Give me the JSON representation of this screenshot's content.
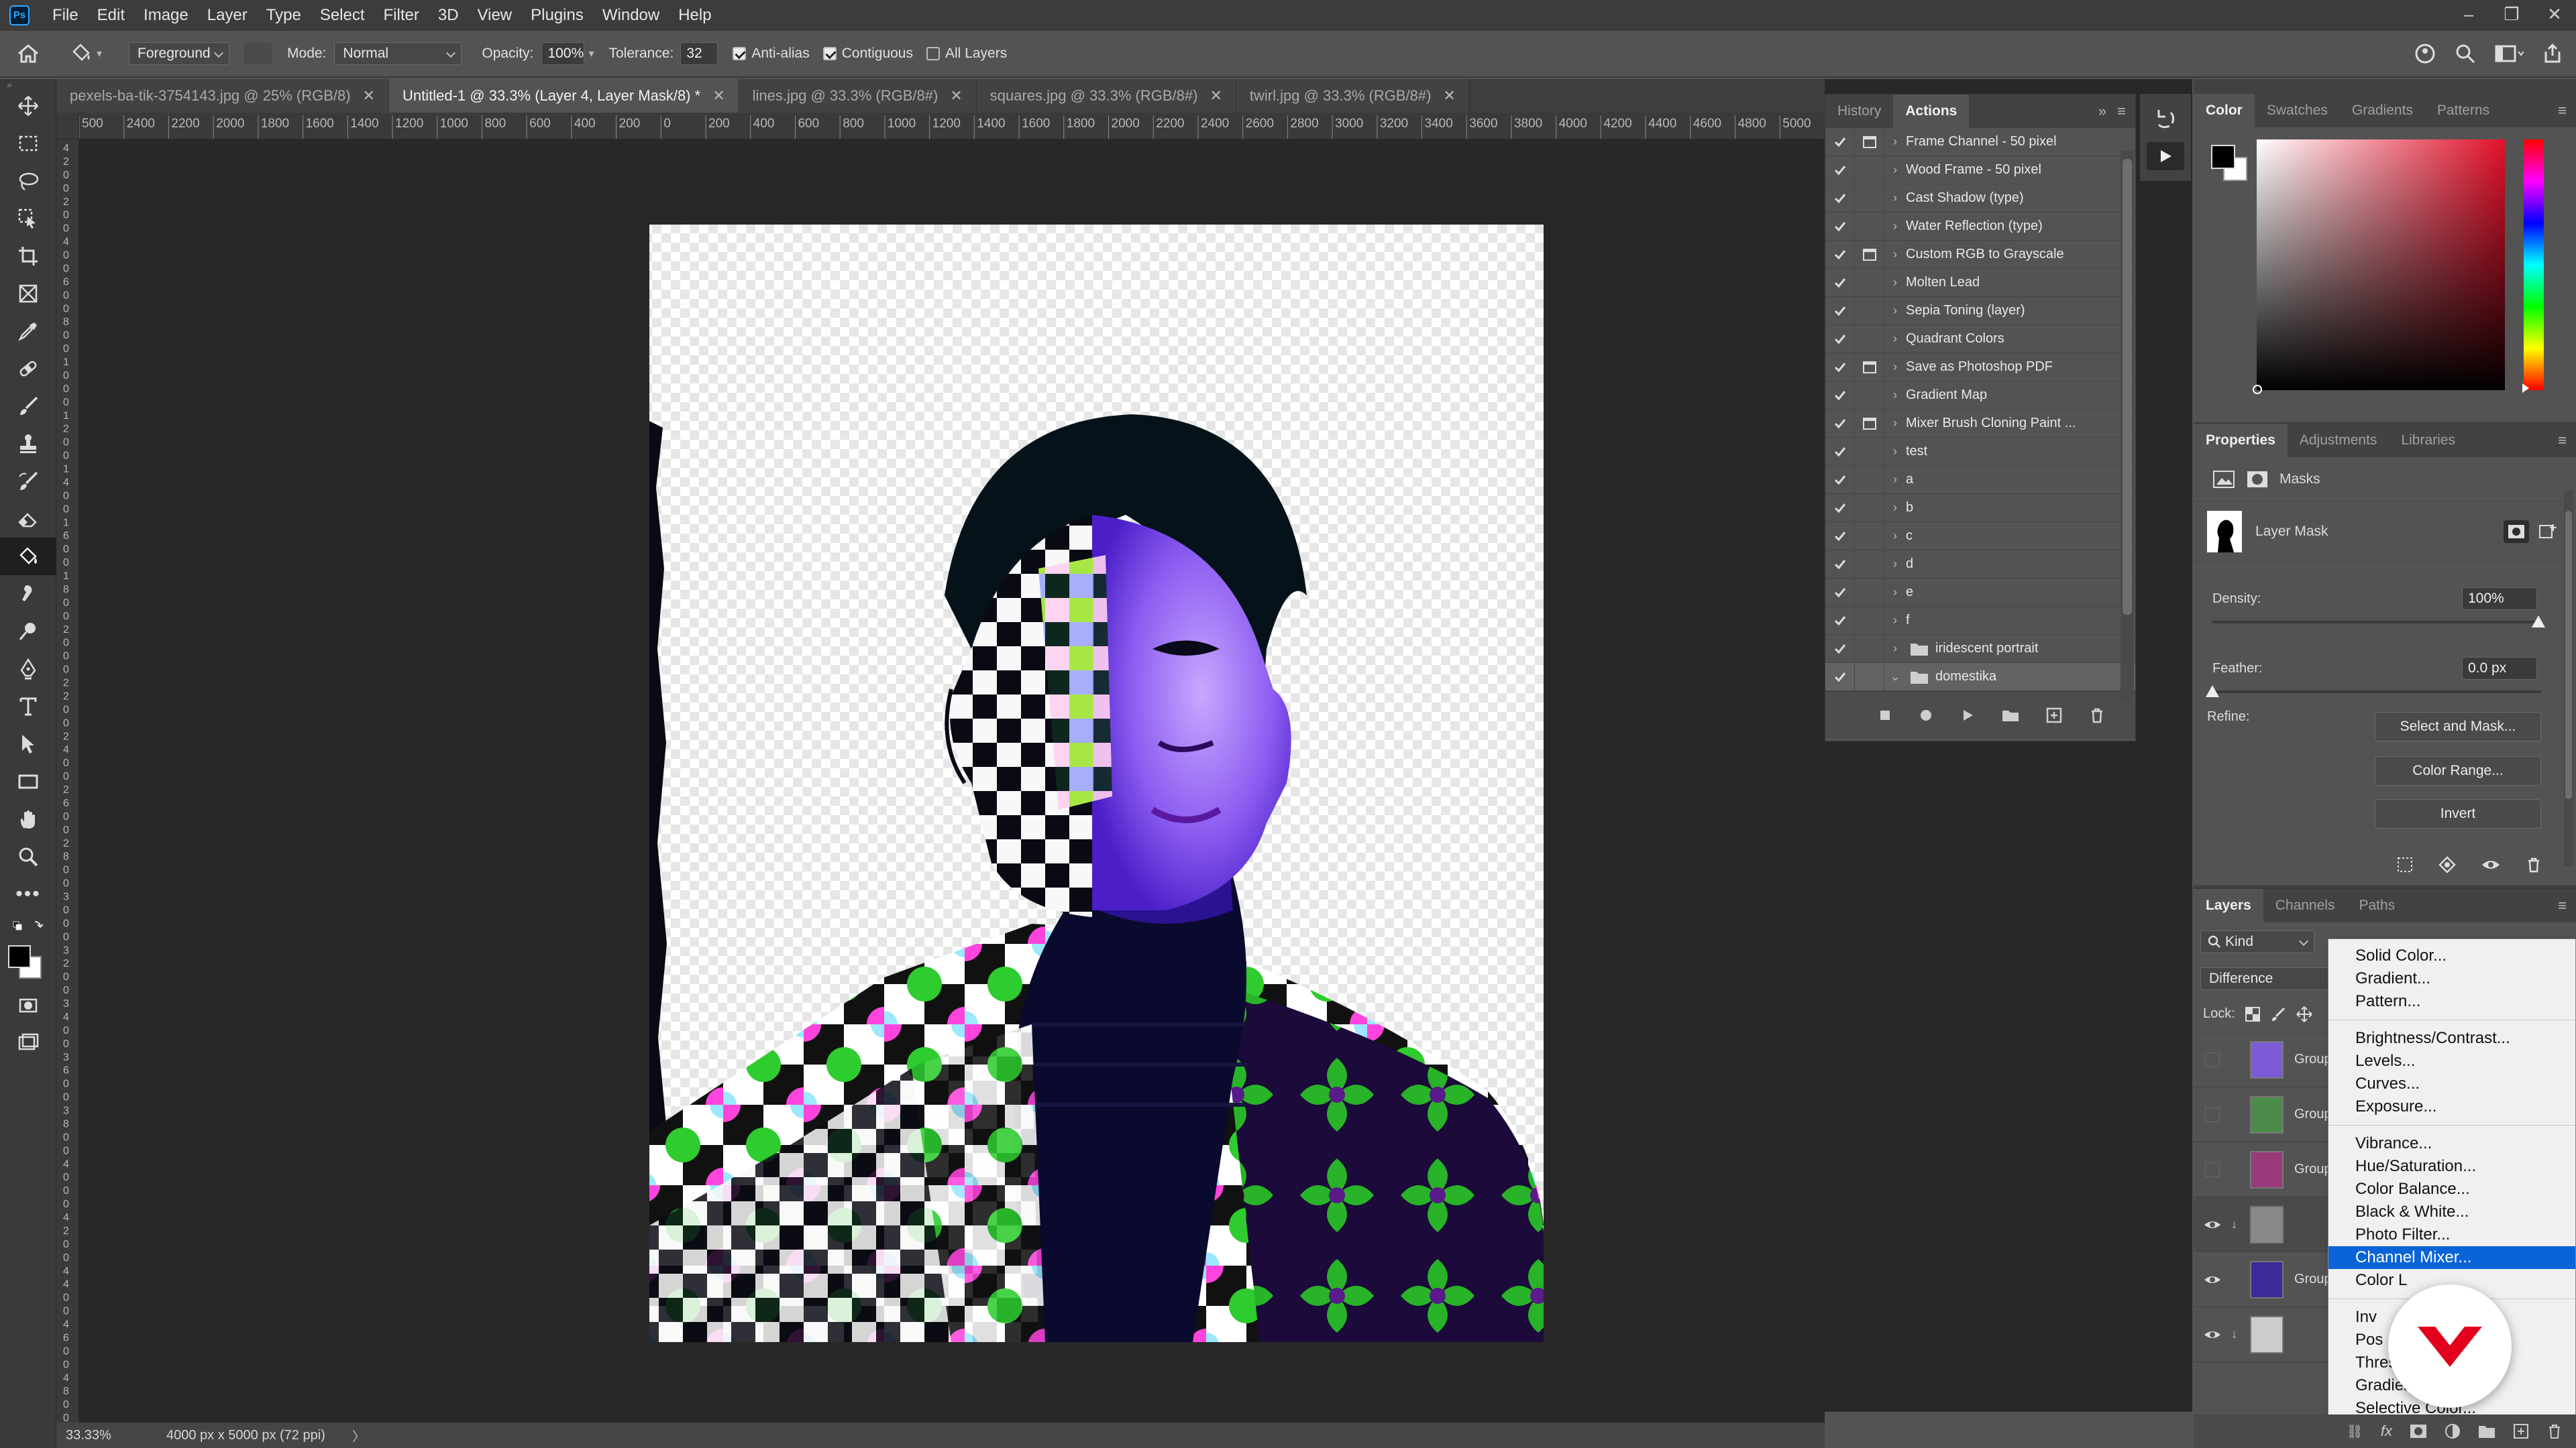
{
  "menubar": {
    "app_badge": "Ps",
    "items": [
      "File",
      "Edit",
      "Image",
      "Layer",
      "Type",
      "Select",
      "Filter",
      "3D",
      "View",
      "Plugins",
      "Window",
      "Help"
    ]
  },
  "options": {
    "fill_source": "Foreground",
    "mode_label": "Mode:",
    "mode_value": "Normal",
    "opacity_label": "Opacity:",
    "opacity_value": "100%",
    "tolerance_label": "Tolerance:",
    "tolerance_value": "32",
    "antialias_label": "Anti-alias",
    "contiguous_label": "Contiguous",
    "all_layers_label": "All Layers"
  },
  "tabs": [
    {
      "label": "pexels-ba-tik-3754143.jpg @ 25% (RGB/8)",
      "active": false
    },
    {
      "label": "Untitled-1 @ 33.3% (Layer 4, Layer Mask/8) *",
      "active": true
    },
    {
      "label": "lines.jpg @ 33.3% (RGB/8#)",
      "active": false
    },
    {
      "label": "squares.jpg @ 33.3% (RGB/8#)",
      "active": false
    },
    {
      "label": "twirl.jpg @ 33.3% (RGB/8#)",
      "active": false
    }
  ],
  "ruler_h": [
    "500",
    "2400",
    "2200",
    "2000",
    "1800",
    "1600",
    "1400",
    "1200",
    "1000",
    "800",
    "600",
    "400",
    "200",
    "0",
    "200",
    "400",
    "600",
    "800",
    "1000",
    "1200",
    "1400",
    "1600",
    "1800",
    "2000",
    "2200",
    "2400",
    "2600",
    "2800",
    "3000",
    "3200",
    "3400",
    "3600",
    "3800",
    "4000",
    "4200",
    "4400",
    "4600",
    "4800",
    "5000"
  ],
  "ruler_v": [
    "4",
    "2",
    "0",
    "0",
    "2",
    "0",
    "0",
    "4",
    "0",
    "0",
    "6",
    "0",
    "0",
    "8",
    "0",
    "0",
    "1",
    "0",
    "0",
    "0",
    "1",
    "2",
    "0",
    "0",
    "1",
    "4",
    "0",
    "0",
    "1",
    "6",
    "0",
    "0",
    "1",
    "8",
    "0",
    "0",
    "2",
    "0",
    "0",
    "0",
    "2",
    "2",
    "0",
    "0",
    "2",
    "4",
    "0",
    "0",
    "2",
    "6",
    "0",
    "0",
    "2",
    "8",
    "0",
    "0",
    "3",
    "0",
    "0",
    "0",
    "3",
    "2",
    "0",
    "0",
    "3",
    "4",
    "0",
    "0",
    "3",
    "6",
    "0",
    "0",
    "3",
    "8",
    "0",
    "0",
    "4",
    "0",
    "0",
    "0",
    "4",
    "2",
    "0",
    "0",
    "4",
    "4",
    "0",
    "0",
    "4",
    "6",
    "0",
    "0",
    "4",
    "8",
    "0",
    "0"
  ],
  "status": {
    "zoom": "33.33%",
    "doc_info": "4000 px x 5000 px (72 ppi)",
    "arrow": "〉"
  },
  "actions_panel": {
    "tabs": [
      "History",
      "Actions"
    ],
    "active_tab": "Actions",
    "items": [
      {
        "label": "Frame Channel - 50 pixel",
        "dialog": true,
        "folder": false
      },
      {
        "label": "Wood Frame - 50 pixel",
        "dialog": false,
        "folder": false
      },
      {
        "label": "Cast Shadow (type)",
        "dialog": false,
        "folder": false
      },
      {
        "label": "Water Reflection (type)",
        "dialog": false,
        "folder": false
      },
      {
        "label": "Custom RGB to Grayscale",
        "dialog": true,
        "folder": false
      },
      {
        "label": "Molten Lead",
        "dialog": false,
        "folder": false
      },
      {
        "label": "Sepia Toning (layer)",
        "dialog": false,
        "folder": false
      },
      {
        "label": "Quadrant Colors",
        "dialog": false,
        "folder": false
      },
      {
        "label": "Save as Photoshop PDF",
        "dialog": true,
        "folder": false
      },
      {
        "label": "Gradient Map",
        "dialog": false,
        "folder": false
      },
      {
        "label": "Mixer Brush Cloning Paint ...",
        "dialog": true,
        "folder": false
      },
      {
        "label": "test",
        "dialog": false,
        "folder": false
      },
      {
        "label": "a",
        "dialog": false,
        "folder": false
      },
      {
        "label": "b",
        "dialog": false,
        "folder": false
      },
      {
        "label": "c",
        "dialog": false,
        "folder": false
      },
      {
        "label": "d",
        "dialog": false,
        "folder": false
      },
      {
        "label": "e",
        "dialog": false,
        "folder": false
      },
      {
        "label": "f",
        "dialog": false,
        "folder": false
      },
      {
        "label": "iridescent portrait",
        "dialog": false,
        "folder": true
      },
      {
        "label": "domestika",
        "dialog": false,
        "folder": true,
        "expanded": true,
        "selected": true
      }
    ]
  },
  "color_panel": {
    "tabs": [
      "Color",
      "Swatches",
      "Gradients",
      "Patterns"
    ],
    "active_tab": "Color",
    "foreground": "#000000",
    "background": "#ffffff",
    "hue": "#ff0000"
  },
  "properties_panel": {
    "tabs": [
      "Properties",
      "Adjustments",
      "Libraries"
    ],
    "active_tab": "Properties",
    "masks_label": "Masks",
    "layer_mask_label": "Layer Mask",
    "density_label": "Density:",
    "density_value": "100%",
    "feather_label": "Feather:",
    "feather_value": "0.0 px",
    "refine_label": "Refine:",
    "select_mask_btn": "Select and Mask...",
    "color_range_btn": "Color Range...",
    "invert_btn": "Invert"
  },
  "layers_panel": {
    "tabs": [
      "Layers",
      "Channels",
      "Paths"
    ],
    "active_tab": "Layers",
    "kind_label": "Kind",
    "blend_mode": "Difference",
    "lock_label": "Lock:",
    "layers": [
      {
        "label": "Group",
        "visible": false
      },
      {
        "label": "Group",
        "visible": false
      },
      {
        "label": "Group",
        "visible": false
      },
      {
        "label": "",
        "visible": true,
        "adjustment": true
      },
      {
        "label": "Group",
        "visible": true
      },
      {
        "label": "",
        "visible": true,
        "adjustment": true
      }
    ]
  },
  "adjust_menu": {
    "groups": [
      [
        "Solid Color...",
        "Gradient...",
        "Pattern..."
      ],
      [
        "Brightness/Contrast...",
        "Levels...",
        "Curves...",
        "Exposure..."
      ],
      [
        "Vibrance...",
        "Hue/Saturation...",
        "Color Balance...",
        "Black & White...",
        "Photo Filter...",
        "Channel Mixer...",
        "Color Lookup..."
      ],
      [
        "Invert",
        "Posterize...",
        "Threshold...",
        "Gradient Map...",
        "Selective Color..."
      ]
    ],
    "visible_text": {
      "color_lookup": "Color L",
      "invert": "Inv",
      "posterize": "Pos",
      "threshold": "Thres",
      "gradient_map": "Gradient"
    },
    "selected": "Channel Mixer..."
  },
  "colors": {
    "accent": "#0a64d8",
    "domestika_badge": "#e2001a"
  }
}
